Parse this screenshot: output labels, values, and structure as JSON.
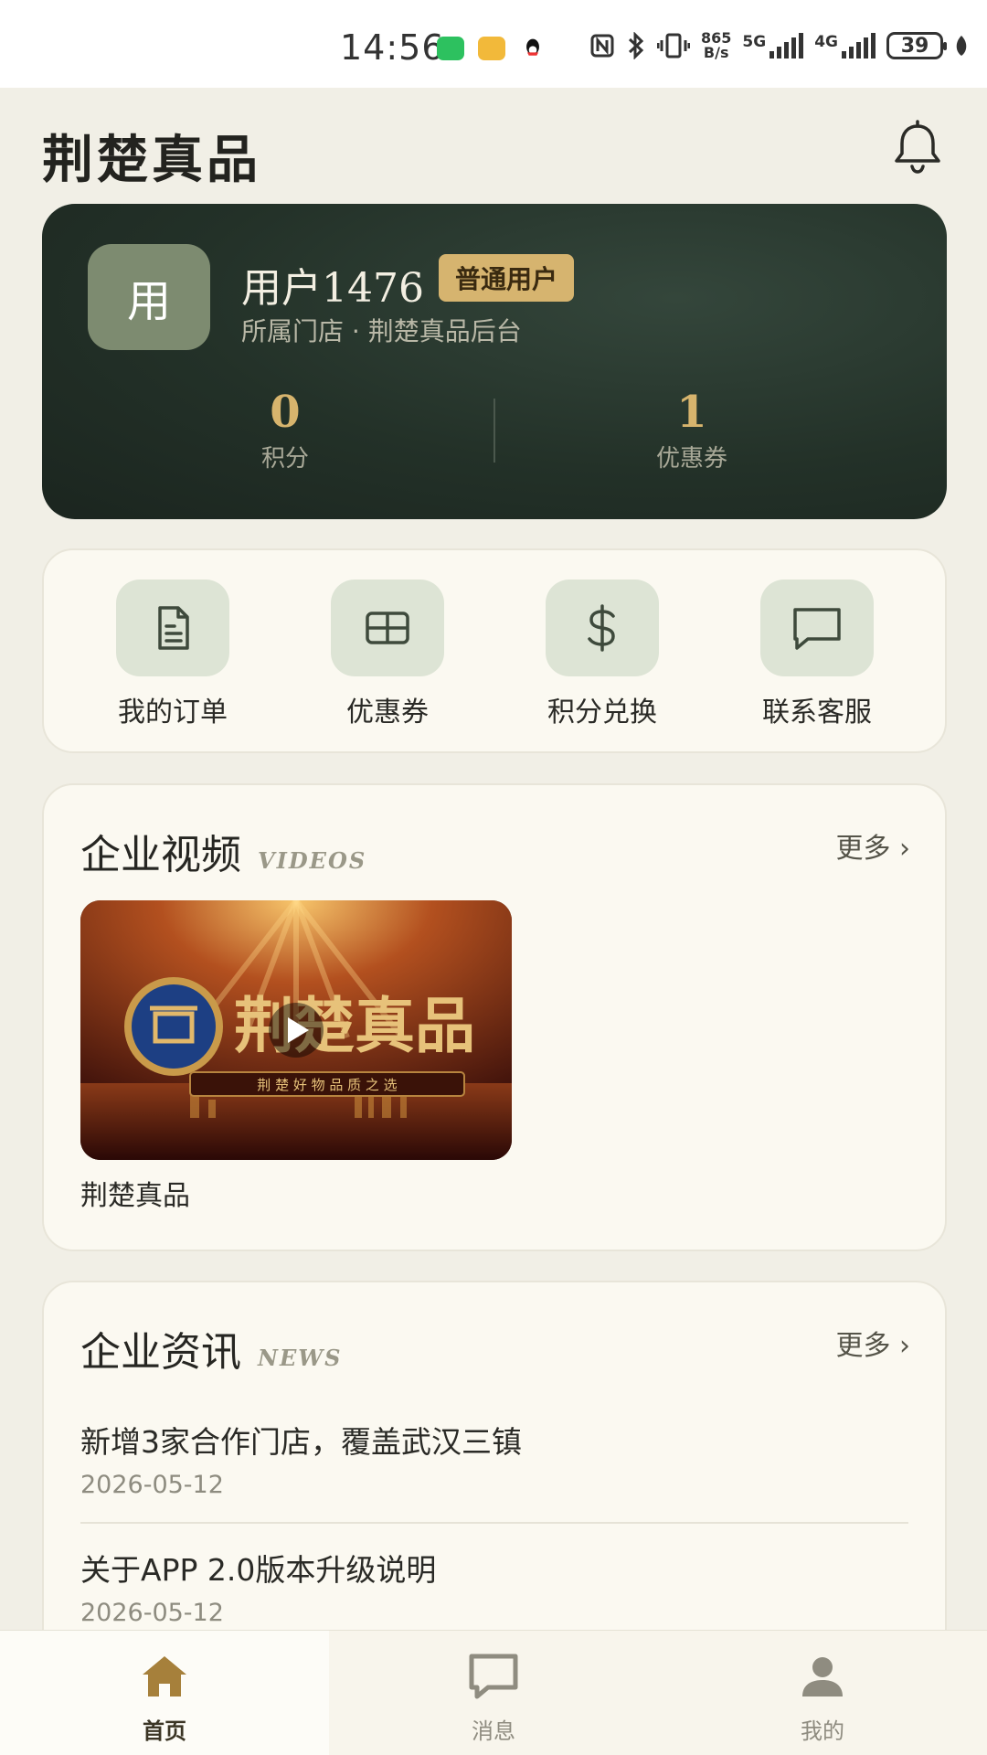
{
  "status_bar": {
    "time": "14:56",
    "net_speed_top": "865",
    "net_speed_bottom": "B/s",
    "sim1": "5G",
    "sim2": "4G",
    "battery": "39"
  },
  "header": {
    "title": "荆楚真品"
  },
  "profile": {
    "avatar_char": "用",
    "username": "用户1476",
    "badge": "普通用户",
    "store_line": "所属门店 · 荆楚真品后台",
    "stats": [
      {
        "value": "0",
        "label": "积分"
      },
      {
        "value": "1",
        "label": "优惠券"
      }
    ]
  },
  "quick_actions": [
    {
      "label": "我的订单",
      "icon": "document-icon"
    },
    {
      "label": "优惠券",
      "icon": "coupon-icon"
    },
    {
      "label": "积分兑换",
      "icon": "dollar-icon"
    },
    {
      "label": "联系客服",
      "icon": "chat-bubble-icon"
    }
  ],
  "videos": {
    "title": "企业视频",
    "subtitle": "VIDEOS",
    "more": "更多 ›",
    "items": [
      {
        "title": "荆楚真品",
        "thumb_title": "荆楚真品",
        "thumb_slogan": "荆 楚 好 物   品 质 之 选"
      }
    ]
  },
  "news": {
    "title": "企业资讯",
    "subtitle": "NEWS",
    "more": "更多 ›",
    "items": [
      {
        "title": "新增3家合作门店，覆盖武汉三镇",
        "date": "2026-05-12"
      },
      {
        "title": "关于APP 2.0版本升级说明",
        "date": "2026-05-12"
      }
    ]
  },
  "tabbar": {
    "tabs": [
      {
        "label": "首页",
        "icon": "home-icon",
        "active": true
      },
      {
        "label": "消息",
        "icon": "message-icon",
        "active": false
      },
      {
        "label": "我的",
        "icon": "person-icon",
        "active": false
      }
    ]
  },
  "colors": {
    "accent_gold": "#d6b46f",
    "card_dark_green": "#233128",
    "icon_tile_green": "#dde4d5",
    "icon_stroke": "#3e4a3c"
  }
}
